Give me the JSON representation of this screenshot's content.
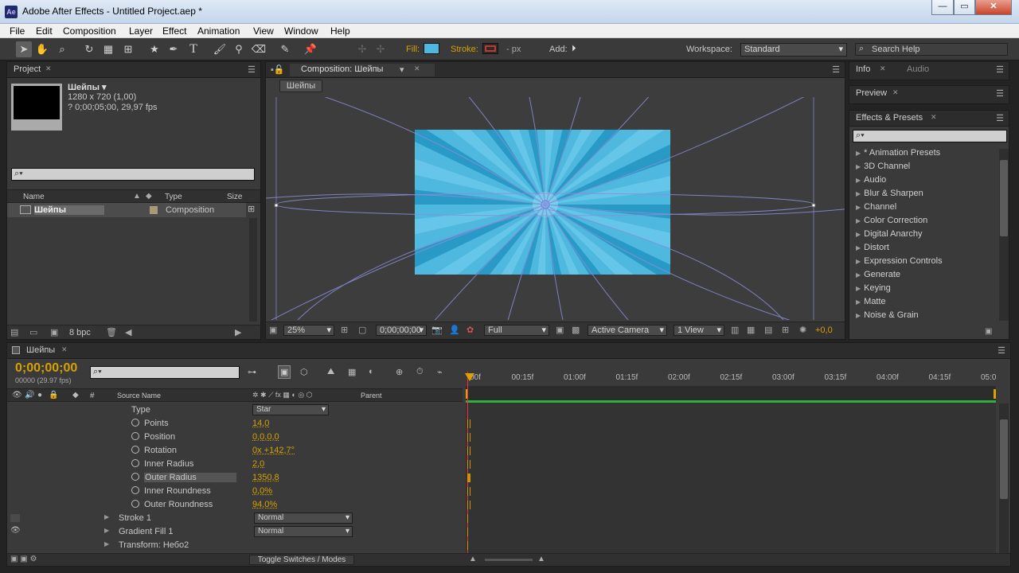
{
  "window": {
    "title": "Adobe After Effects - Untitled Project.aep *",
    "app_icon": "Ae"
  },
  "menu": [
    "File",
    "Edit",
    "Composition",
    "Layer",
    "Effect",
    "Animation",
    "View",
    "Window",
    "Help"
  ],
  "toolbar": {
    "fill_label": "Fill:",
    "stroke_label": "Stroke:",
    "px_label": "- px",
    "add_label": "Add:",
    "workspace_label": "Workspace:",
    "workspace_value": "Standard",
    "search_placeholder": "Search Help",
    "fill_color": "#4db8e0",
    "stroke_color": "#c0392b"
  },
  "project": {
    "tab": "Project",
    "comp_name": "Шейпы ▾",
    "comp_size": "1280 x 720 (1,00)",
    "comp_duration": "? 0;00;05;00, 29,97 fps",
    "col_name": "Name",
    "col_type": "Type",
    "col_size": "Size",
    "item_name": "Шейпы",
    "item_type": "Composition",
    "bpc": "8 bpc"
  },
  "composition": {
    "tab": "Composition: Шейпы",
    "crumb": "Шейпы",
    "zoom": "25%",
    "timecode": "0;00;00;00",
    "resolution": "Full",
    "camera": "Active Camera",
    "views": "1 View",
    "exposure": "+0,0"
  },
  "right": {
    "info_tab": "Info",
    "audio_tab": "Audio",
    "preview_tab": "Preview",
    "effects_tab": "Effects & Presets",
    "effects": [
      "* Animation Presets",
      "3D Channel",
      "Audio",
      "Blur & Sharpen",
      "Channel",
      "Color Correction",
      "Digital Anarchy",
      "Distort",
      "Expression Controls",
      "Generate",
      "Keying",
      "Matte",
      "Noise & Grain"
    ]
  },
  "timeline": {
    "tab": "Шейпы",
    "timecode": "0;00;00;00",
    "fps": "00000 (29.97 fps)",
    "col_source": "Source Name",
    "col_parent": "Parent",
    "col_hash": "#",
    "ruler": [
      "00f",
      "00:15f",
      "01:00f",
      "01:15f",
      "02:00f",
      "02:15f",
      "03:00f",
      "03:15f",
      "04:00f",
      "04:15f",
      "05:0"
    ],
    "type_label": "Type",
    "type_value": "Star",
    "properties": [
      {
        "name": "Points",
        "value": "14,0"
      },
      {
        "name": "Position",
        "value": "0,0,0,0"
      },
      {
        "name": "Rotation",
        "value": "0x +142,7°"
      },
      {
        "name": "Inner Radius",
        "value": "2,0"
      },
      {
        "name": "Outer Radius",
        "value": "1350,8"
      },
      {
        "name": "Inner Roundness",
        "value": "0,0%"
      },
      {
        "name": "Outer Roundness",
        "value": "94,0%"
      }
    ],
    "groups": [
      {
        "name": "Stroke 1",
        "mode": "Normal"
      },
      {
        "name": "Gradient Fill 1",
        "mode": "Normal"
      },
      {
        "name": "Transform: Небо2",
        "mode": ""
      }
    ],
    "toggle_label": "Toggle Switches / Modes"
  }
}
